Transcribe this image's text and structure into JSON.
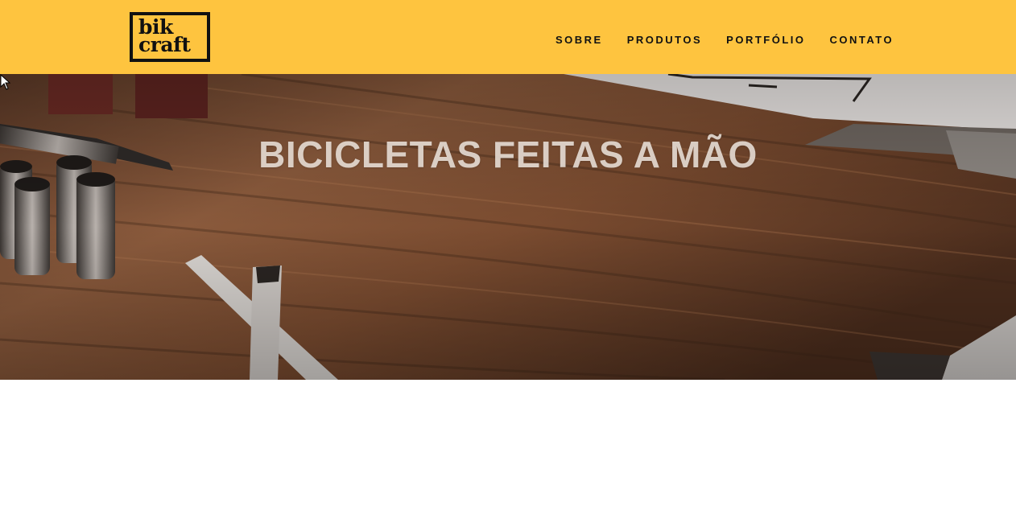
{
  "header": {
    "logo": {
      "line1": "bik",
      "line2": "craft"
    },
    "nav": [
      {
        "label": "Sobre"
      },
      {
        "label": "Produtos"
      },
      {
        "label": "Portfólio"
      },
      {
        "label": "Contato"
      }
    ]
  },
  "hero": {
    "title": "BICICLETAS FEITAS A MÃO",
    "background_image": "workbench-tools-icon"
  },
  "colors": {
    "header_bg": "#fec43f",
    "text_dark": "#111111",
    "wood": "#7a4a2e"
  }
}
